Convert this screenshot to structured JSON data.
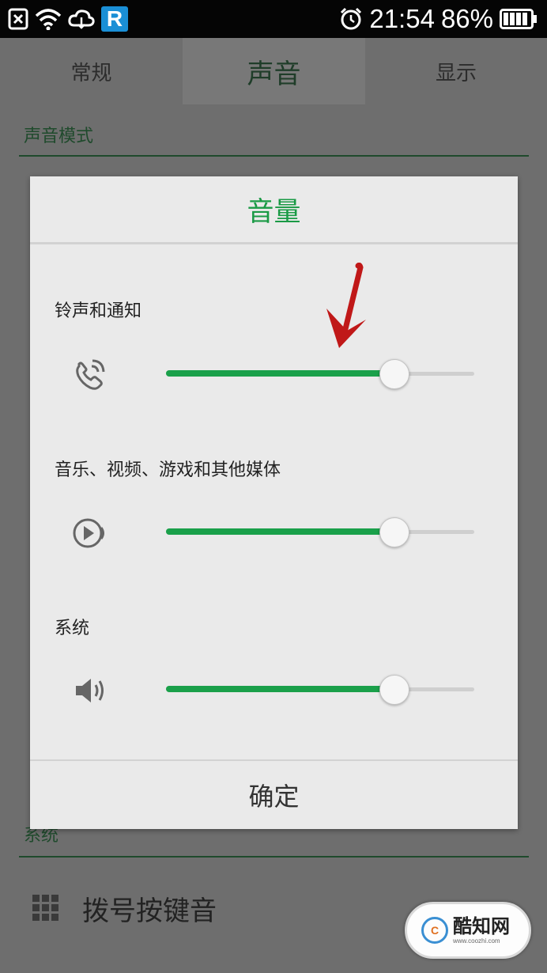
{
  "status_bar": {
    "time": "21:54",
    "battery_percent": "86%",
    "app_badge": "R",
    "icons": [
      "notification-x-icon",
      "wifi-icon",
      "cloud-sync-icon",
      "r-app-icon",
      "alarm-icon",
      "battery-icon"
    ]
  },
  "tabs": [
    {
      "label": "常规"
    },
    {
      "label": "声音",
      "active": true
    },
    {
      "label": "显示"
    }
  ],
  "background": {
    "section_sound_mode": "声音模式",
    "section_system": "系统",
    "row_dial_keypad": "拨号按键音"
  },
  "dialog": {
    "title": "音量",
    "confirm_label": "确定",
    "items": [
      {
        "label": "铃声和通知",
        "icon": "ringtone-phone-icon",
        "level": 0.74
      },
      {
        "label": "音乐、视频、游戏和其他媒体",
        "icon": "media-play-icon",
        "level": 0.74
      },
      {
        "label": "系统",
        "icon": "speaker-icon",
        "level": 0.74
      }
    ]
  },
  "watermark": {
    "logo": "C",
    "name": "酷知网",
    "url": "www.coozhi.com"
  },
  "colors": {
    "accent": "#1aa04a",
    "title_green": "#1a9a45",
    "arrow": "#c01818"
  }
}
